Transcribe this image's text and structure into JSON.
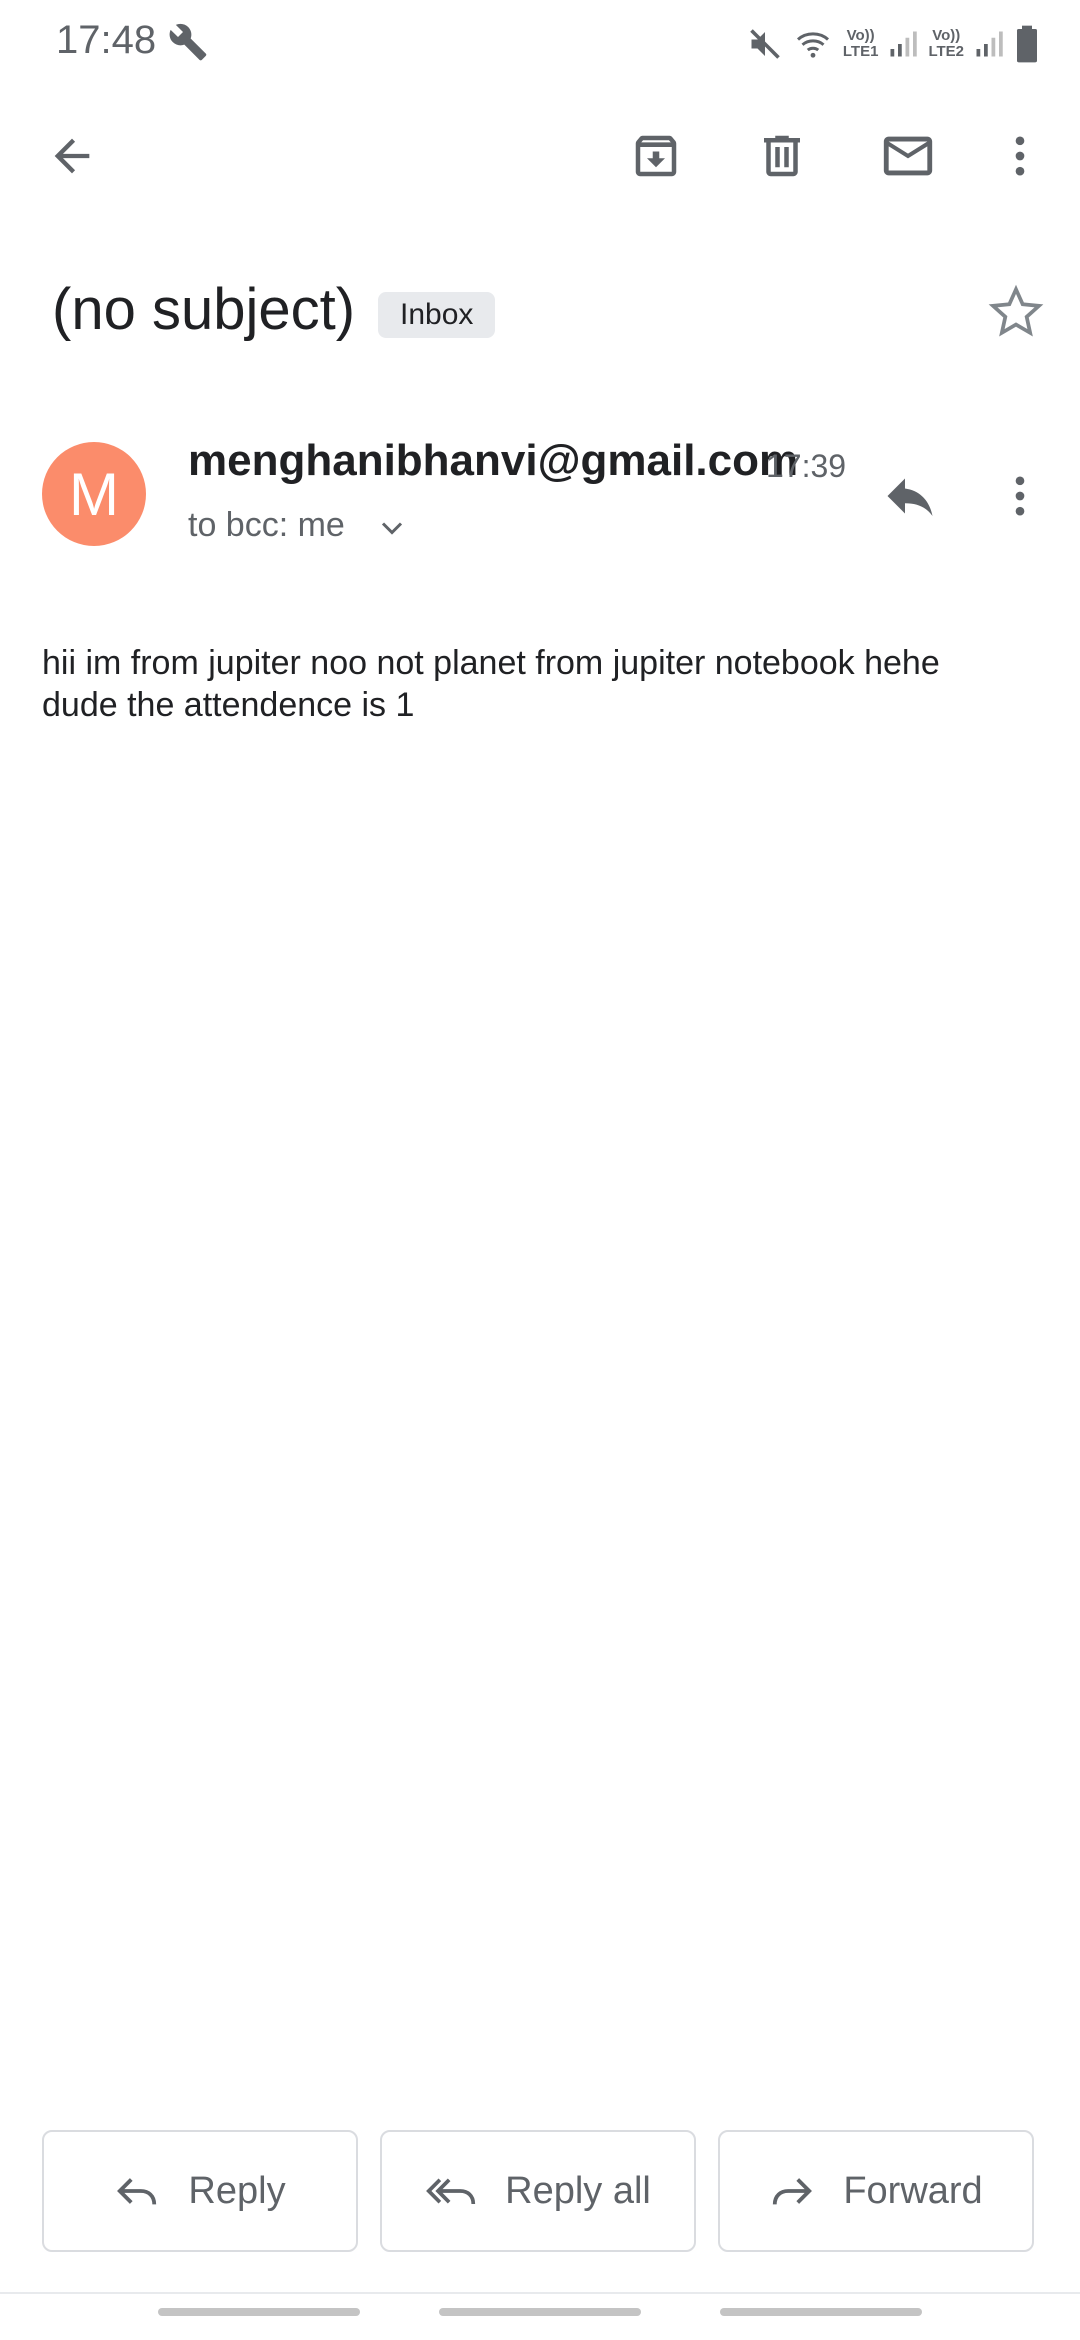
{
  "status_bar": {
    "time": "17:48",
    "sim1": {
      "top": "Vo))",
      "bottom": "LTE1"
    },
    "sim2": {
      "top": "Vo))",
      "bottom": "LTE2"
    }
  },
  "toolbar": {
    "icons": [
      "back-arrow-icon",
      "archive-icon",
      "delete-icon",
      "mark-unread-icon",
      "more-vert-icon"
    ]
  },
  "email": {
    "subject": "(no subject)",
    "label": "Inbox",
    "starred": false,
    "sender": "menghanibhanvi@gmail.com",
    "avatar_letter": "M",
    "avatar_color": "#fb8c6b",
    "time": "17:39",
    "recipients": "to bcc: me",
    "body_lines": [
      "hii im from jupiter noo not planet from jupiter notebook hehe",
      "dude the attendence is 1"
    ]
  },
  "actions": {
    "reply": "Reply",
    "reply_all": "Reply all",
    "forward": "Forward"
  },
  "colors": {
    "accent_icon": "#5f6368",
    "text": "#202124",
    "chip_bg": "#e8eaed"
  }
}
